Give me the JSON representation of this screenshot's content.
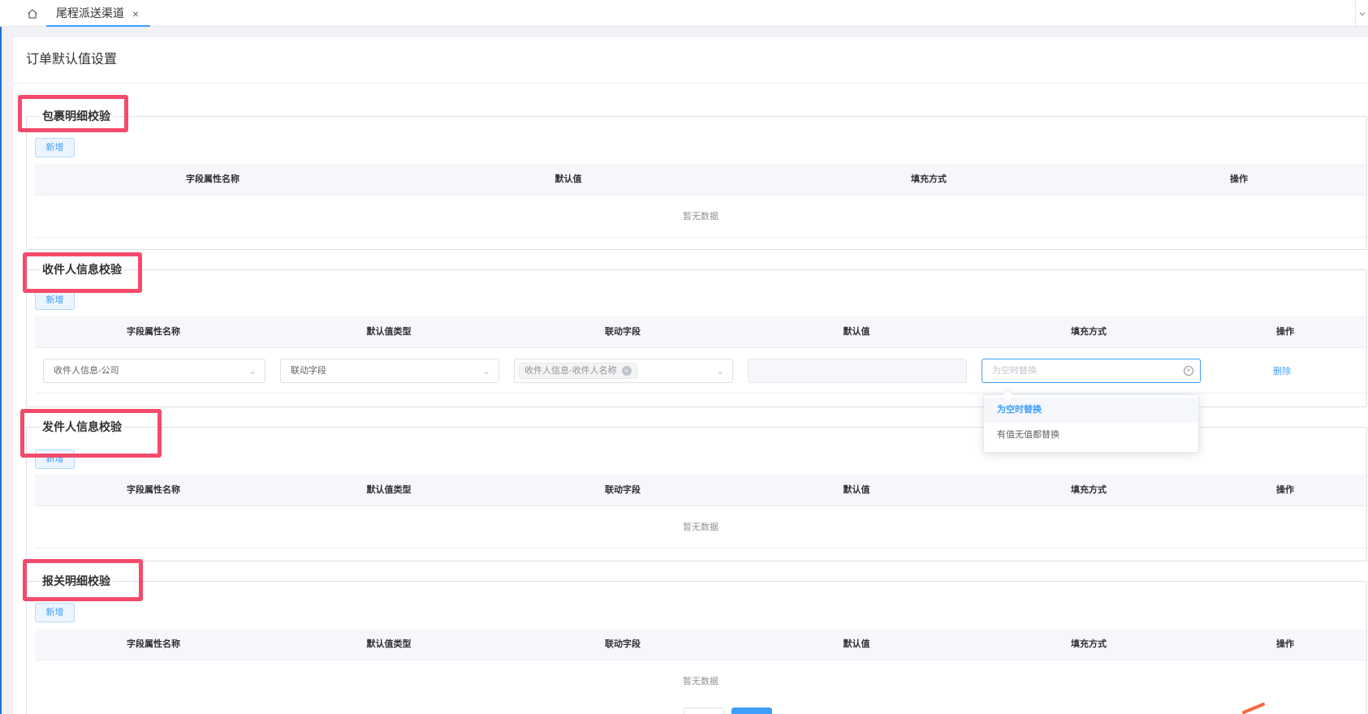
{
  "tabs": {
    "home_icon": "home-icon",
    "active_label": "尾程派送渠道",
    "close_glyph": "×"
  },
  "page": {
    "title": "订单默认值设置"
  },
  "sections": {
    "parcel": {
      "legend": "包裹明细校验",
      "add_label": "新增",
      "columns": [
        "字段属性名称",
        "默认值",
        "填充方式",
        "操作"
      ],
      "empty_text": "暂无数据"
    },
    "receiver": {
      "legend": "收件人信息校验",
      "add_label": "新增",
      "columns": [
        "字段属性名称",
        "默认值类型",
        "联动字段",
        "默认值",
        "填充方式",
        "操作"
      ],
      "row": {
        "field_name": "收件人信息-公司",
        "value_type": "联动字段",
        "linked_tag": "收件人信息-收件人名称",
        "default_value": "",
        "fill_placeholder": "为空时替换",
        "delete_label": "删除"
      }
    },
    "sender": {
      "legend": "发件人信息校验",
      "add_label": "新增",
      "columns": [
        "字段属性名称",
        "默认值类型",
        "联动字段",
        "默认值",
        "填充方式",
        "操作"
      ],
      "empty_text": "暂无数据"
    },
    "customs": {
      "legend": "报关明细校验",
      "add_label": "新增",
      "columns": [
        "字段属性名称",
        "默认值类型",
        "联动字段",
        "默认值",
        "填充方式",
        "操作"
      ],
      "empty_text": "暂无数据"
    }
  },
  "fill_dropdown": {
    "options": [
      "为空时替换",
      "有值无值都替换"
    ],
    "selected": "为空时替换"
  },
  "colors": {
    "accent": "#409eff",
    "highlight_box": "#f44b6b"
  }
}
